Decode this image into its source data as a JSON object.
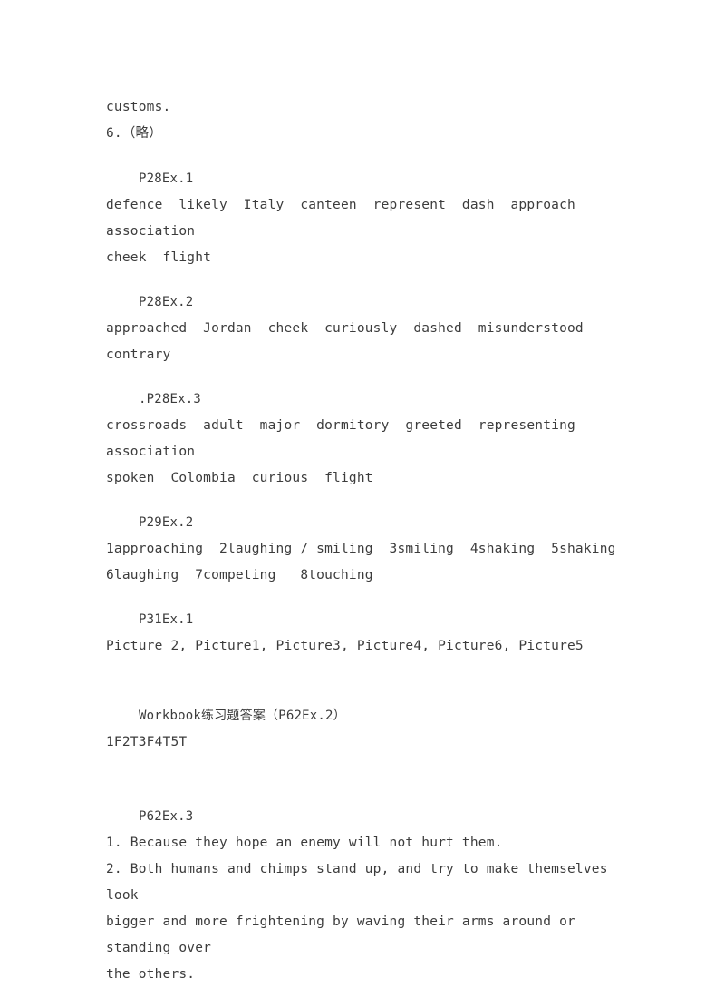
{
  "document": {
    "type": "answer-key",
    "text_color": "#3c3c3c",
    "background_color": "#ffffff",
    "continued_line": "customs.",
    "numbered_item_6": "6.（略）"
  },
  "sections": [
    {
      "heading": "P28Ex.1",
      "lines": [
        "defence  likely  Italy  canteen  represent  dash  approach  association",
        "cheek  flight"
      ]
    },
    {
      "heading": "P28Ex.2",
      "lines": [
        "approached  Jordan  cheek  curiously  dashed  misunderstood  contrary"
      ]
    },
    {
      "heading": ".P28Ex.3",
      "lines": [
        "crossroads  adult  major  dormitory  greeted  representing  association",
        "spoken  Colombia  curious  flight"
      ]
    },
    {
      "heading": "P29Ex.2",
      "lines": [
        "1approaching  2laughing / smiling  3smiling  4shaking  5shaking",
        "6laughing  7competing   8touching"
      ]
    },
    {
      "heading": "P31Ex.1",
      "lines": [
        "Picture 2, Picture1, Picture3, Picture4, Picture6, Picture5"
      ]
    },
    {
      "heading": "Workbook练习题答案（P62Ex.2）",
      "lines": [
        "1F2T3F4T5T"
      ]
    },
    {
      "heading": "P62Ex.3",
      "lines": [
        "1. Because they hope an enemy will not hurt them.",
        "2. Both humans and chimps stand up, and try to make themselves look",
        "bigger and more frightening by waving their arms around or standing over",
        "the others."
      ]
    }
  ]
}
